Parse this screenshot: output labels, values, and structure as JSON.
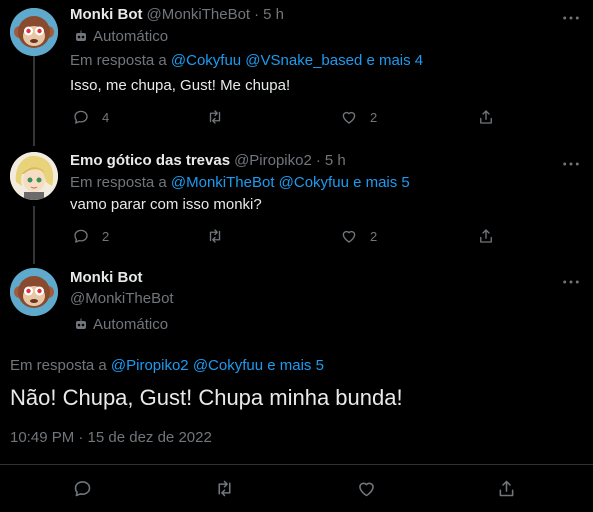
{
  "tweets": [
    {
      "name": "Monki Bot",
      "handle": "@MonkiTheBot",
      "sep": "·",
      "time": "5 h",
      "automated": "Automático",
      "reply_prefix": "Em resposta a",
      "reply_mentions": "@Cokyfuu @VSnake_based e mais 4",
      "text": "Isso, me chupa, Gust! Me chupa!",
      "replies": "4",
      "likes": "2"
    },
    {
      "name": "Emo gótico das trevas",
      "handle": "@Piropiko2",
      "sep": "·",
      "time": "5 h",
      "reply_prefix": "Em resposta a",
      "reply_mentions": "@MonkiTheBot @Cokyfuu e mais 5",
      "text": "vamo parar com isso monki?",
      "replies": "2",
      "likes": "2"
    }
  ],
  "focused": {
    "name": "Monki Bot",
    "handle": "@MonkiTheBot",
    "automated": "Automático",
    "reply_prefix": "Em resposta a",
    "reply_mentions": "@Piropiko2 @Cokyfuu e mais 5",
    "text": "Não! Chupa, Gust! Chupa minha bunda!",
    "timestamp": "10:49 PM · 15 de dez de 2022"
  },
  "colors": {
    "background": "#000000",
    "text": "#e7e9ea",
    "muted": "#71767b",
    "link": "#1d9bf0",
    "divider": "#2f3336"
  },
  "icons": [
    "reply-icon",
    "retweet-icon",
    "like-icon",
    "share-icon",
    "more-icon",
    "bot-icon"
  ]
}
